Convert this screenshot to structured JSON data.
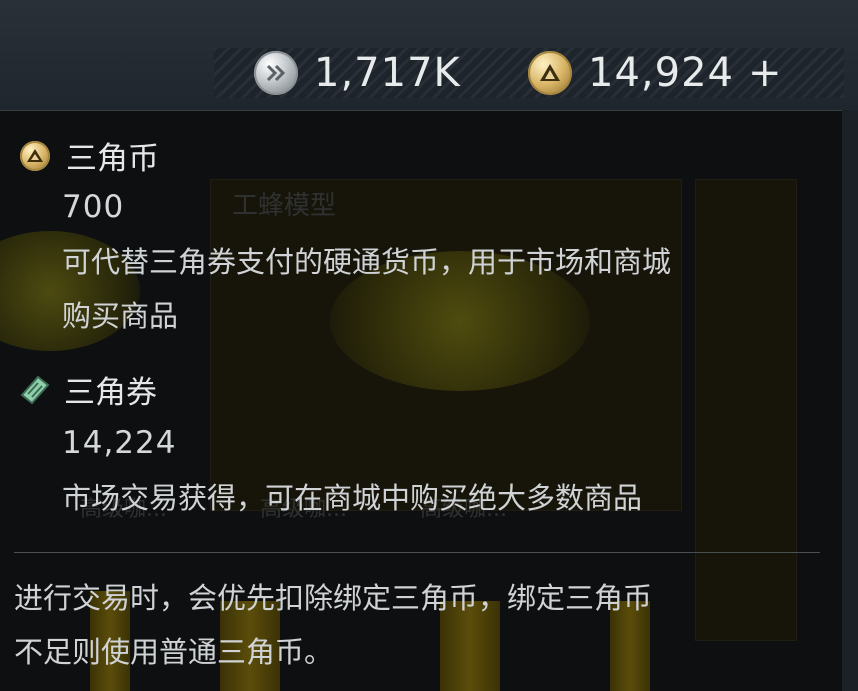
{
  "header": {
    "silver_value": "1,717K",
    "gold_value": "14,924",
    "plus_label": "+"
  },
  "background": {
    "card_title": "工蜂模型",
    "card_labels": [
      "高级咖...",
      "高级咖...",
      "高级咖..."
    ]
  },
  "tooltip": {
    "triangle_coin": {
      "name": "三角币",
      "amount": "700",
      "description_line1": "可代替三角券支付的硬通货币，用于市场和商城",
      "description_line2": "购买商品"
    },
    "triangle_voucher": {
      "name": "三角券",
      "amount": "14,224",
      "description": "市场交易获得，可在商城中购买绝大多数商品"
    },
    "note_line1": "进行交易时，会优先扣除绑定三角币，绑定三角币",
    "note_line2": "不足则使用普通三角币。"
  },
  "colors": {
    "gold_coin": "#d8b465",
    "silver_coin": "#bfc4c8",
    "voucher": "#7fbf9a",
    "panel_bg": "#0d0f10",
    "top_bg": "#2a3038"
  },
  "icons": {
    "silver": "silver-coin-icon",
    "gold": "triangle-coin-icon",
    "voucher": "triangle-voucher-icon"
  }
}
